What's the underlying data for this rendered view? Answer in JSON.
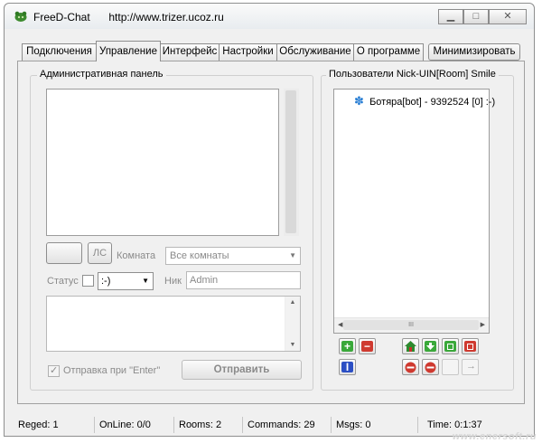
{
  "window": {
    "title": "FreeD-Chat",
    "url": "http://www.trizer.ucoz.ru",
    "controls": {
      "minimize": "▁",
      "maximize": "□",
      "close": "✕"
    }
  },
  "tabs": [
    {
      "label": "Подключения"
    },
    {
      "label": "Управление",
      "active": true
    },
    {
      "label": "Интерфейс"
    },
    {
      "label": "Настройки"
    },
    {
      "label": "Обслуживание"
    },
    {
      "label": "О программе"
    }
  ],
  "minimize_button": "Минимизировать",
  "admin": {
    "title": "Административная панель",
    "log_text": "",
    "color_button": "",
    "ls_button": "ЛС",
    "room_label": "Комната",
    "room_value": "Все комнаты",
    "status_label": "Статус",
    "status_checked": false,
    "status_value": ":-)",
    "nick_label": "Ник",
    "nick_value": "Admin",
    "message_text": "",
    "send_on_enter_label": "Отправка при \"Enter\"",
    "send_on_enter_checked": true,
    "send_button": "Отправить"
  },
  "users": {
    "title": "Пользователи Nick-UIN[Room] Smile",
    "items": [
      {
        "text": "Ботяра[bot] - 9392524 [0] :-)",
        "icon": "snowflake-user-icon",
        "color": "#2a7fd4"
      }
    ],
    "scroll_mark": "III",
    "tool_icons": [
      "add-user-icon",
      "remove-user-icon",
      "home-icon",
      "download-icon",
      "green-square-icon",
      "red-square-icon",
      "text-cursor-icon",
      "ban-icon",
      "block-icon",
      "blank-icon",
      "arrow-right-icon"
    ]
  },
  "statusbar": {
    "reged": "Reged: 1",
    "online": "OnLine: 0/0",
    "rooms": "Rooms: 2",
    "commands": "Commands: 29",
    "msgs": "Msgs: 0",
    "time": "Time: 0:1:37"
  },
  "watermark": "www.enersoft.ru",
  "colors": {
    "accent_green": "#2f9e2f",
    "accent_red": "#c8312b",
    "window_bg": "#f0f0f0"
  }
}
